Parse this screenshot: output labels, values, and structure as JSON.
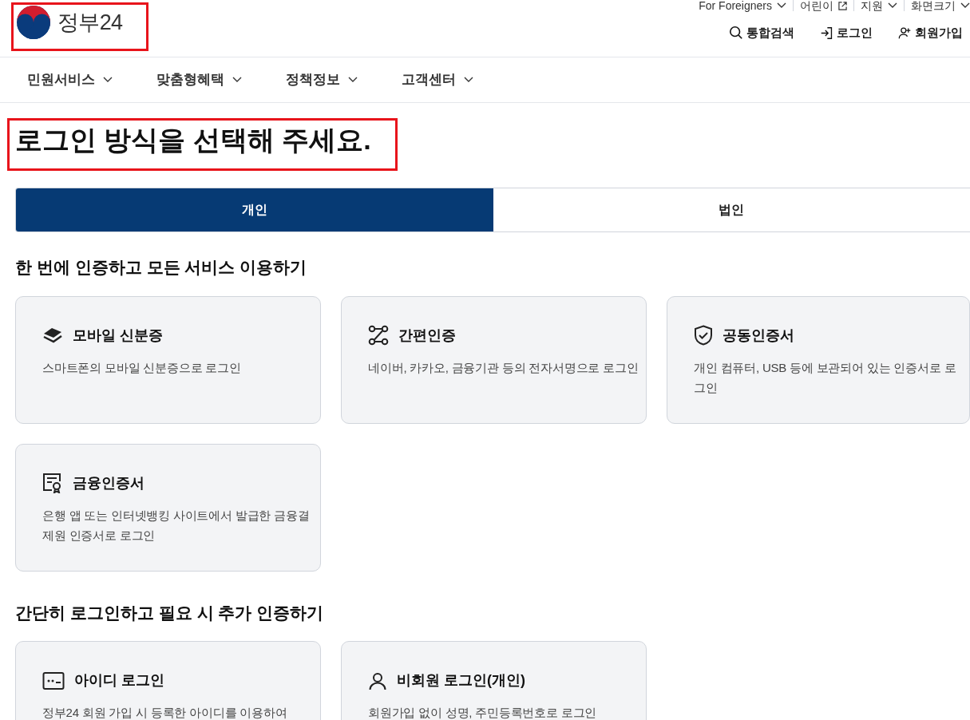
{
  "header": {
    "logo_text": "정부24",
    "utility_links": [
      {
        "label": "For Foreigners",
        "kind": "dropdown"
      },
      {
        "label": "어린이",
        "kind": "external"
      },
      {
        "label": "지원",
        "kind": "dropdown"
      },
      {
        "label": "화면크기",
        "kind": "dropdown"
      }
    ],
    "actions": [
      {
        "label": "통합검색",
        "kind": "search"
      },
      {
        "label": "로그인",
        "kind": "login"
      },
      {
        "label": "회원가입",
        "kind": "signup"
      }
    ]
  },
  "nav": [
    "민원서비스",
    "맞춤형혜택",
    "정책정보",
    "고객센터"
  ],
  "page_title": "로그인 방식을 선택해 주세요.",
  "tabs": [
    {
      "label": "개인",
      "selected": true
    },
    {
      "label": "법인",
      "selected": false
    }
  ],
  "sections": [
    {
      "title": "한 번에 인증하고 모든 서비스 이용하기",
      "cards": [
        {
          "title": "모바일 신분증",
          "description": "스마트폰의 모바일 신분증으로 로그인",
          "kind": "mobile-id"
        },
        {
          "title": "간편인증",
          "description": "네이버, 카카오, 금융기관 등의 전자서명으로 로그인",
          "kind": "simple"
        },
        {
          "title": "공동인증서",
          "description": "개인 컴퓨터, USB 등에 보관되어 있는 인증서로 로그인",
          "kind": "joint"
        },
        {
          "title": "금융인증서",
          "description": "은행 앱 또는 인터넷뱅킹 사이트에서 발급한 금융결제원 인증서로 로그인",
          "kind": "finance"
        }
      ]
    },
    {
      "title": "간단히 로그인하고 필요 시 추가 인증하기",
      "cards": [
        {
          "title": "아이디 로그인",
          "description": "정부24 회원 가입 시 등록한 아이디를 이용하여",
          "kind": "id"
        },
        {
          "title": "비회원 로그인(개인)",
          "description": "회원가입 없이 성명, 주민등록번호로 로그인",
          "kind": "guest"
        }
      ]
    }
  ]
}
